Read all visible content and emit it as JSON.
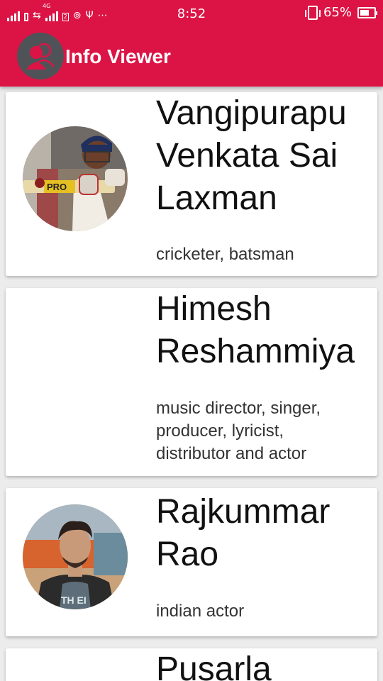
{
  "status_bar": {
    "network": "4G",
    "sim_slot": "2",
    "time": "8:52",
    "battery": "65%",
    "battery_level": 0.65,
    "icons": [
      "signal-icon",
      "data-arrows-icon",
      "hotspot-icon",
      "usb-icon",
      "more-dots-icon",
      "vibrate-icon",
      "battery-icon"
    ]
  },
  "app_bar": {
    "title": "Info Viewer",
    "logo_icon": "people-icon"
  },
  "colors": {
    "primary": "#dc1445",
    "card_bg": "#ffffff",
    "page_bg": "#ececec"
  },
  "people": [
    {
      "name_lines": [
        "Vangipurapu",
        "Venkata Sai",
        "Laxman"
      ],
      "description": "cricketer, batsman",
      "has_photo": true
    },
    {
      "name_lines": [
        "Himesh",
        "Reshammiya"
      ],
      "description_lines": [
        "music director, singer,",
        "producer, lyricist,",
        "distributor and actor"
      ],
      "has_photo": false
    },
    {
      "name_lines": [
        "Rajkummar",
        "Rao"
      ],
      "description": "indian actor",
      "has_photo": true
    },
    {
      "name_lines": [
        "Pusarla"
      ],
      "has_photo": false
    }
  ]
}
